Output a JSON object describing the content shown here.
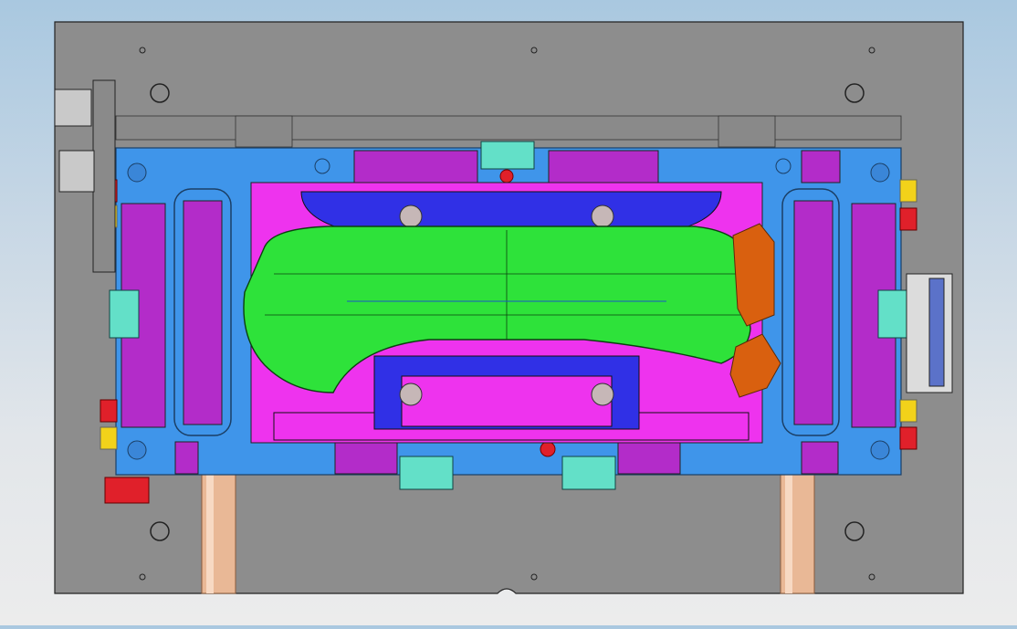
{
  "scene": {
    "description_label": "",
    "colors": {
      "background_top": "#a9c8e0",
      "background_bottom": "#ececec",
      "mold_plate": "#8d8d8d",
      "cavity_frame": "#3f95ea",
      "pocket_magenta": "#ee33ee",
      "slider_purple": "#b32cc9",
      "part_green": "#2ee23a",
      "deep_blue": "#3030e6",
      "lifter_orange": "#d9600f",
      "cyan_block": "#63e0c8",
      "yellow_fitting": "#f2d21a",
      "red_fitting": "#e0202a",
      "support_pillar": "#e9b896",
      "outline": "#222222"
    },
    "icons": [
      "mold-base-plate",
      "cavity-insert",
      "bumper-part",
      "side-slider",
      "lifter-block",
      "cooling-connector",
      "guide-pin-hole",
      "support-pillar",
      "hydraulic-cylinder",
      "terminal-block"
    ]
  }
}
